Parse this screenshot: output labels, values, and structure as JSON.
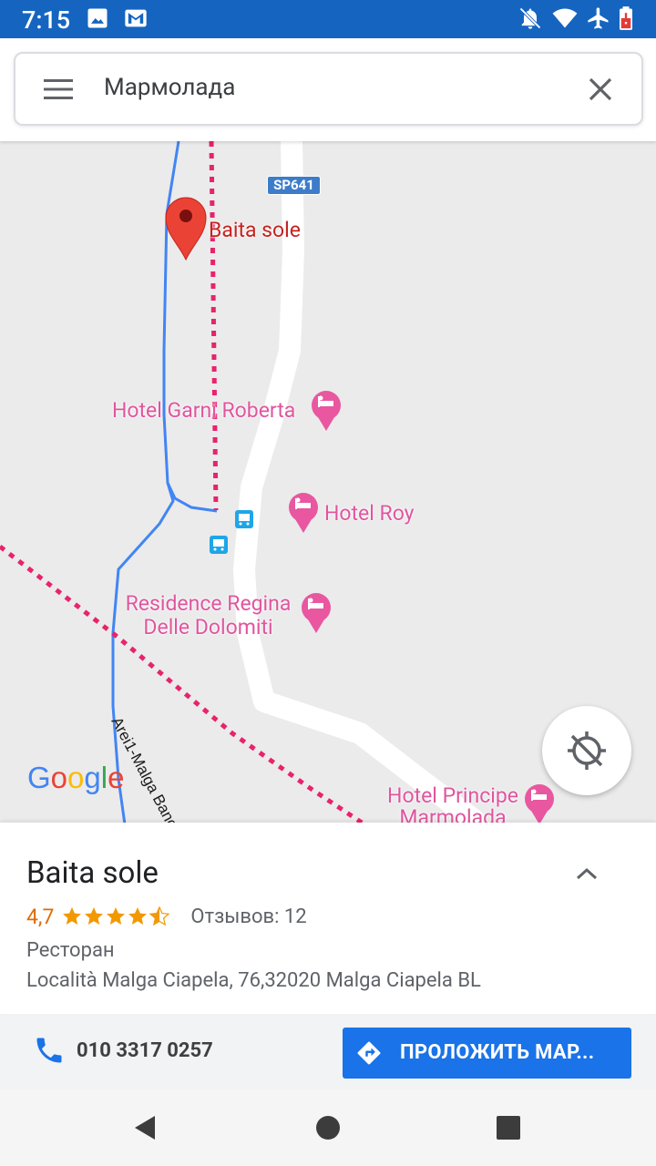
{
  "status_bar": {
    "time": "7:15",
    "left_icons": [
      "image-icon",
      "gmail-icon"
    ],
    "right_icons": [
      "notifications-off-icon",
      "wifi-icon",
      "airplane-icon",
      "battery-alert-icon"
    ],
    "background_color": "#1565c0"
  },
  "search": {
    "menu_icon": "menu-icon",
    "query": "Мармолада",
    "clear_icon": "close-icon"
  },
  "map": {
    "road_shield": "SP641",
    "pin_label": "Baita sole",
    "hotels": [
      "Hotel Garni Roberta",
      "Hotel Roy",
      "Residence Regina Delle Dolomiti",
      "Hotel Principe Marmolada"
    ],
    "trail_label": "Arei1-Malga Banc",
    "logo": "Google",
    "locate_icon": "gps-off-icon",
    "bus_icon": "bus-stop-icon"
  },
  "place": {
    "name": "Baita sole",
    "rating": "4,7",
    "stars": 4.7,
    "reviews": "Отзывов: 12",
    "category": "Ресторан",
    "address": "Località Malga Ciapela, 76,32020 Malga Ciapela BL"
  },
  "actions": {
    "phone_icon": "phone-icon",
    "phone": "010 3317 0257",
    "route_icon": "directions-icon",
    "route_label": "ПРОЛОЖИТЬ МАР...",
    "accent_color": "#1a73e8"
  },
  "nav": {
    "buttons": [
      "back-icon",
      "home-icon",
      "recents-icon"
    ]
  }
}
